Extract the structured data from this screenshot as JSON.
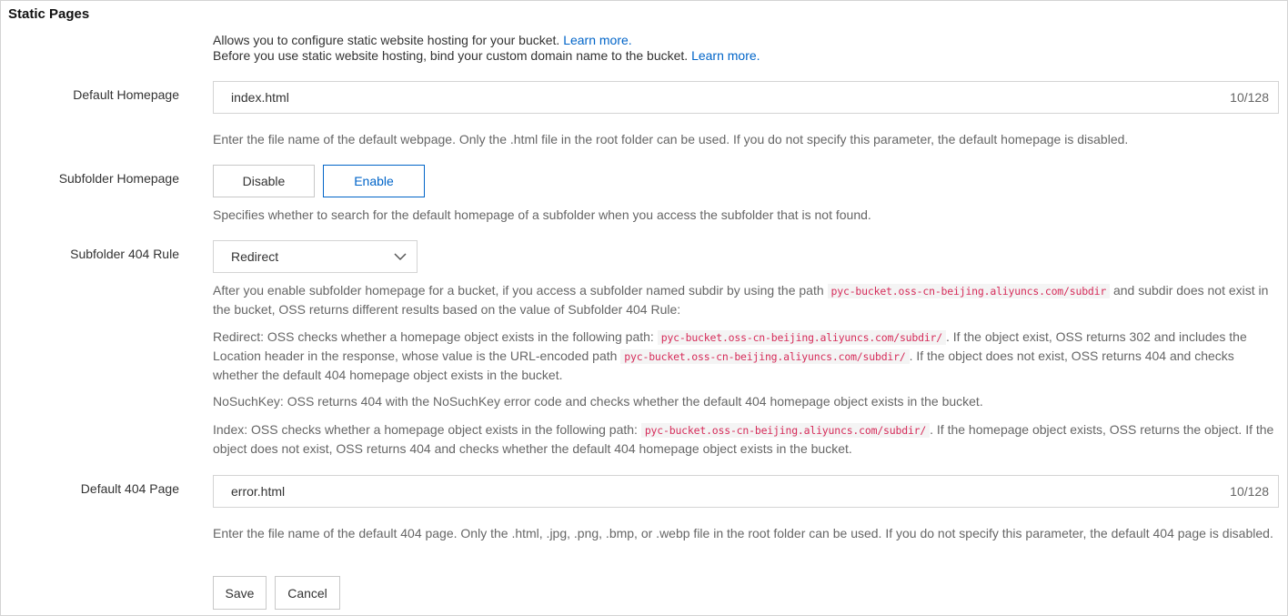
{
  "panel": {
    "title": "Static Pages",
    "intro": {
      "line1_text": "Allows you to configure static website hosting for your bucket.",
      "line1_link": "Learn more.",
      "line2_text": "Before you use static website hosting, bind your custom domain name to the bucket.",
      "line2_link": "Learn more."
    }
  },
  "default_homepage": {
    "label": "Default Homepage",
    "value": "index.html",
    "counter": "10/128",
    "help": "Enter the file name of the default webpage. Only the .html file in the root folder can be used. If you do not specify this parameter, the default homepage is disabled."
  },
  "subfolder_homepage": {
    "label": "Subfolder Homepage",
    "options": [
      "Disable",
      "Enable"
    ],
    "selected": "Enable",
    "help": "Specifies whether to search for the default homepage of a subfolder when you access the subfolder that is not found."
  },
  "subfolder_404_rule": {
    "label": "Subfolder 404 Rule",
    "selected": "Redirect",
    "desc": {
      "p1_a": "After you enable subfolder homepage for a bucket, if you access a subfolder named subdir by using the path",
      "p1_code": "pyc-bucket.oss-cn-beijing.aliyuncs.com/subdir",
      "p1_b": "and subdir does not exist in the bucket, OSS returns different results based on the value of Subfolder 404 Rule:",
      "p2_a": "Redirect: OSS checks whether a homepage object exists in the following path:",
      "p2_code1": "pyc-bucket.oss-cn-beijing.aliyuncs.com/subdir/",
      "p2_b": ". If the object exist, OSS returns 302 and includes the Location header in the response, whose value is the URL-encoded path",
      "p2_code2": "pyc-bucket.oss-cn-beijing.aliyuncs.com/subdir/",
      "p2_c": ". If the object does not exist, OSS returns 404 and checks whether the default 404 homepage object exists in the bucket.",
      "p3": "NoSuchKey: OSS returns 404 with the NoSuchKey error code and checks whether the default 404 homepage object exists in the bucket.",
      "p4_a": "Index: OSS checks whether a homepage object exists in the following path:",
      "p4_code": "pyc-bucket.oss-cn-beijing.aliyuncs.com/subdir/",
      "p4_b": ". If the homepage object exists, OSS returns the object. If the object does not exist, OSS returns 404 and checks whether the default 404 homepage object exists in the bucket."
    }
  },
  "default_404_page": {
    "label": "Default 404 Page",
    "value": "error.html",
    "counter": "10/128",
    "help": "Enter the file name of the default 404 page. Only the .html, .jpg, .png, .bmp, or .webp file in the root folder can be used. If you do not specify this parameter, the default 404 page is disabled."
  },
  "actions": {
    "save": "Save",
    "cancel": "Cancel"
  },
  "colors": {
    "link": "#0064c8",
    "code_text": "#d62c5a",
    "code_bg": "#f4f4f4",
    "border": "#d4d4d4"
  },
  "icons": {
    "select_arrow": "chevron-down-icon"
  }
}
